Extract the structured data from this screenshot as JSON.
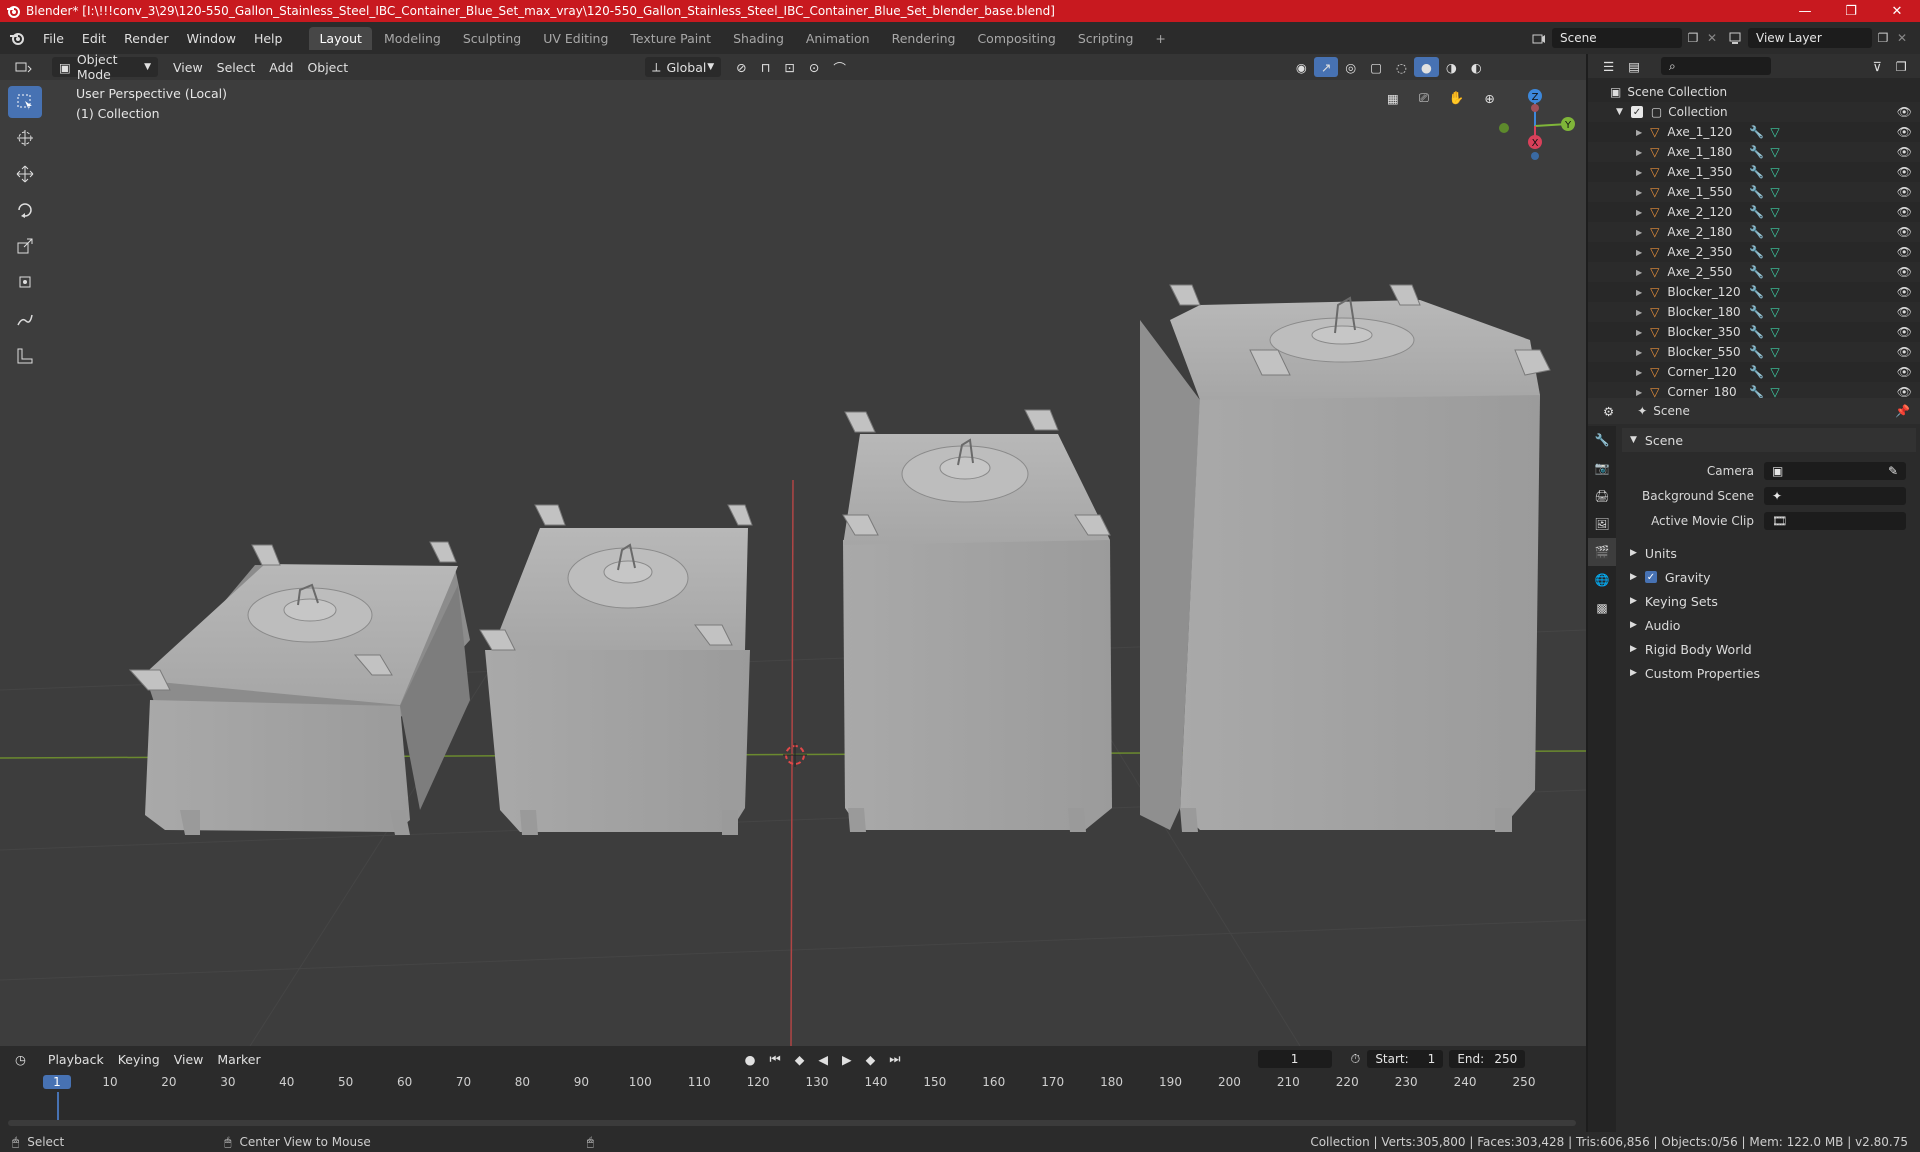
{
  "window": {
    "title": "Blender* [I:\\!!!conv_3\\29\\120-550_Gallon_Stainless_Steel_IBC_Container_Blue_Set_max_vray\\120-550_Gallon_Stainless_Steel_IBC_Container_Blue_Set_blender_base.blend]",
    "controls": [
      "—",
      "❐",
      "✕"
    ]
  },
  "menubar": {
    "menus": [
      "File",
      "Edit",
      "Render",
      "Window",
      "Help"
    ],
    "workspaces": [
      "Layout",
      "Modeling",
      "Sculpting",
      "UV Editing",
      "Texture Paint",
      "Shading",
      "Animation",
      "Rendering",
      "Compositing",
      "Scripting"
    ],
    "active_workspace": "Layout",
    "add_tab": "+",
    "scene_name": "Scene",
    "view_layer": "View Layer"
  },
  "viewport": {
    "mode": "Object Mode",
    "menus": [
      "View",
      "Select",
      "Add",
      "Object"
    ],
    "transform_orientation": "Global",
    "perspective_label": "User Perspective (Local)",
    "collection_label": "(1) Collection",
    "gizmo": {
      "z": "Z",
      "y": "Y",
      "x": "X"
    }
  },
  "outliner": {
    "root": "Scene Collection",
    "collection": "Collection",
    "items": [
      "Axe_1_120",
      "Axe_1_180",
      "Axe_1_350",
      "Axe_1_550",
      "Axe_2_120",
      "Axe_2_180",
      "Axe_2_350",
      "Axe_2_550",
      "Blocker_120",
      "Blocker_180",
      "Blocker_350",
      "Blocker_550",
      "Corner_120",
      "Corner_180"
    ]
  },
  "properties": {
    "context": "Scene",
    "panel_title": "Scene",
    "camera_label": "Camera",
    "background_scene_label": "Background Scene",
    "active_movie_clip_label": "Active Movie Clip",
    "sections": [
      "Units",
      "Gravity",
      "Keying Sets",
      "Audio",
      "Rigid Body World",
      "Custom Properties"
    ],
    "gravity_checked": true
  },
  "timeline": {
    "menus": [
      "Playback",
      "Keying",
      "View",
      "Marker"
    ],
    "current_frame": "1",
    "start_label": "Start:",
    "start": "1",
    "end_label": "End:",
    "end": "250",
    "ticks": [
      "1",
      "10",
      "20",
      "30",
      "40",
      "50",
      "60",
      "70",
      "80",
      "90",
      "100",
      "110",
      "120",
      "130",
      "140",
      "150",
      "160",
      "170",
      "180",
      "190",
      "200",
      "210",
      "220",
      "230",
      "240",
      "250"
    ]
  },
  "statusbar": {
    "select": "Select",
    "center_view": "Center View to Mouse",
    "stats": "Collection | Verts:305,800 | Faces:303,428 | Tris:606,856 | Objects:0/56 | Mem: 122.0 MB | v2.80.75"
  },
  "colors": {
    "titlebar": "#c8191f",
    "accent": "#4772b3",
    "viewport_bg": "#3d3d3d",
    "x_axis": "#d9405a",
    "y_axis": "#7fb539",
    "z_axis": "#3d88db"
  }
}
